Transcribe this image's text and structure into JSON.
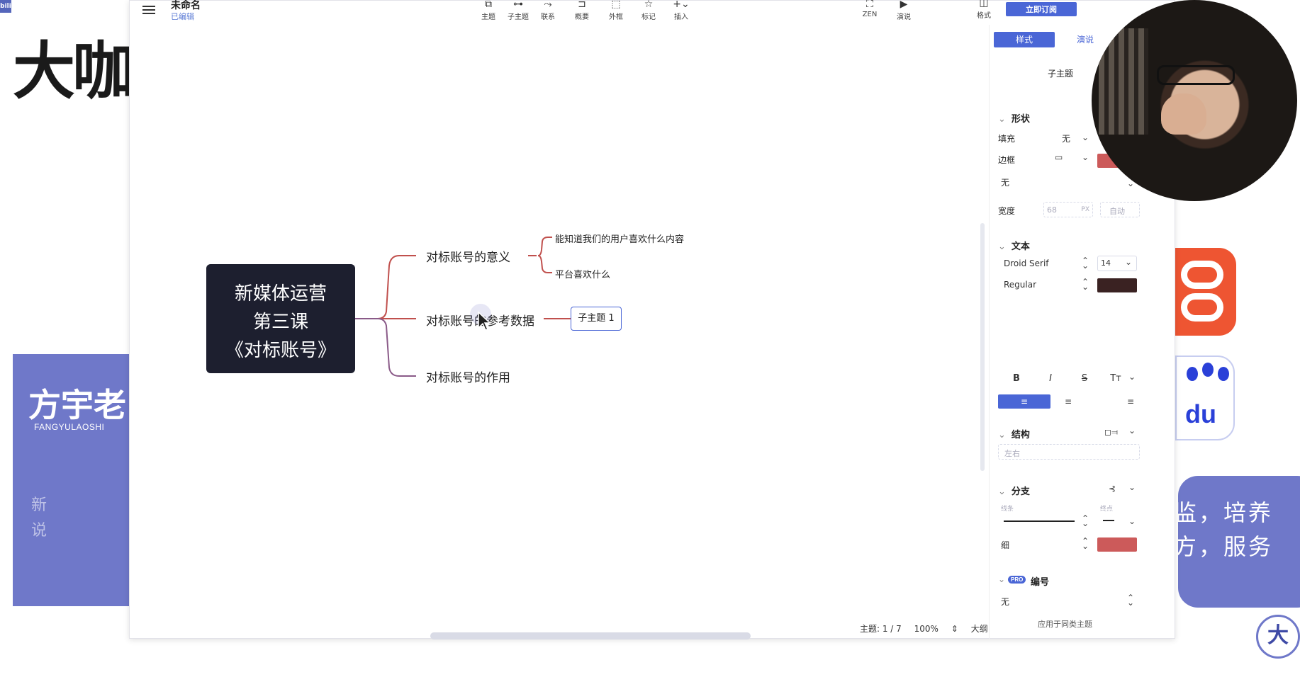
{
  "background": {
    "big_title": "大咖",
    "watermark": "bilibili",
    "name_text": "方宇老!",
    "name_sub": "FANGYULAOSHI",
    "faint_text": [
      "新",
      "说"
    ],
    "right_card_lines": [
      "监，培养",
      "方，服务"
    ],
    "paw_text": "du",
    "bottom_icon_text": "大"
  },
  "window": {
    "doc_title": "未命名",
    "doc_status": "已编辑"
  },
  "toolbar": {
    "items": [
      {
        "label": "主题",
        "icon": "topic-icon",
        "glyph": "⧉"
      },
      {
        "label": "子主题",
        "icon": "subtopic-icon",
        "glyph": "⊶"
      },
      {
        "label": "联系",
        "icon": "relationship-icon",
        "glyph": "⤳"
      },
      {
        "label": "概要",
        "icon": "summary-icon",
        "glyph": "⊐"
      },
      {
        "label": "外框",
        "icon": "boundary-icon",
        "glyph": "⬚"
      },
      {
        "label": "标记",
        "icon": "marker-icon",
        "glyph": "☆"
      },
      {
        "label": "插入",
        "icon": "insert-icon",
        "glyph": "+⌄"
      }
    ],
    "zen_label": "ZEN",
    "present_label": "演说",
    "format_label": "格式",
    "subscribe_label": "立即订阅"
  },
  "mindmap": {
    "central": [
      "新媒体运营",
      "第三课",
      "《对标账号》"
    ],
    "branches": [
      {
        "label": "对标账号的意义",
        "children": [
          "能知道我们的用户喜欢什么内容",
          "平台喜欢什么"
        ]
      },
      {
        "label": "对标账号的参考数据",
        "children": [
          "子主题 1"
        ]
      },
      {
        "label": "对标账号的作用",
        "children": []
      }
    ],
    "colors": {
      "central_bg": "#1d1f2f",
      "branch_line": "#c0504d",
      "branch_line_lower": "#8a5a88",
      "selected_border": "#4a66d6"
    }
  },
  "status": {
    "topic_count": "主题: 1 / 7",
    "zoom": "100%",
    "outline": "大纲"
  },
  "panel": {
    "tabs": [
      "样式",
      "演说"
    ],
    "topic_type": "子主题",
    "shape_section": "形状",
    "fill_label": "填充",
    "fill_value": "无",
    "border_label": "边框",
    "border_color": "#cc5a5a",
    "border_style_value": "无",
    "width_label": "宽度",
    "width_value": "68",
    "width_unit": "PX",
    "width_auto": "自动",
    "text_section": "文本",
    "font_family": "Droid Serif",
    "font_size": "14",
    "font_weight": "Regular",
    "text_color": "#3a2222",
    "format_buttons": [
      "B",
      "I",
      "S",
      "Tт"
    ],
    "align_buttons": [
      "≡",
      "≡",
      "≡"
    ],
    "structure_section": "结构",
    "structure_value": "左右",
    "branch_section": "分支",
    "line_label": "线条",
    "endpoint_label": "终点",
    "thickness_value": "细",
    "branch_color": "#cc5a5a",
    "numbering_section": "编号",
    "pro_badge": "PRO",
    "numbering_value": "无",
    "apply_to_same": "应用于同类主题"
  }
}
